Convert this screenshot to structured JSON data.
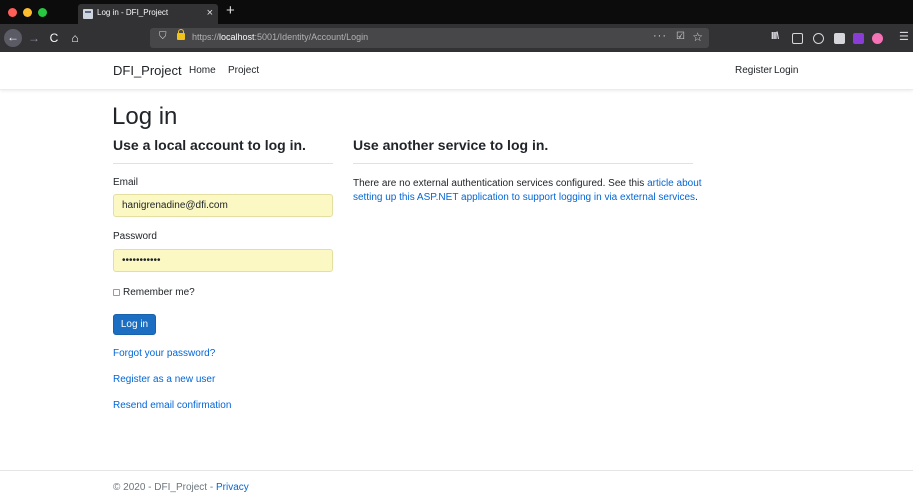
{
  "browser": {
    "tab_title": "Log in - DFI_Project",
    "tab_close": "×",
    "new_tab": "+",
    "url_scheme": "https://",
    "url_host": "localhost",
    "url_path": ":5001/Identity/Account/Login",
    "url_more": "···",
    "icons": [
      "back-icon",
      "forward-icon",
      "reload-icon",
      "home-icon",
      "shield-icon",
      "lock-icon",
      "pocket-icon",
      "bookmark-star-icon",
      "library-icon",
      "sidebar-icon",
      "account-icon",
      "extension-icon",
      "menu-icon"
    ],
    "back_glyph": "←",
    "forward_glyph": "→",
    "reload_glyph": "C",
    "home_glyph": "⌂",
    "shield_glyph": "⛉",
    "pocket_glyph": "☑",
    "star_glyph": "☆",
    "library_glyph": "III\\",
    "menu_glyph": "☰"
  },
  "site_nav": {
    "brand": "DFI_Project",
    "links": [
      "Home",
      "Project"
    ],
    "right_links": [
      "Register",
      "Login"
    ]
  },
  "main": {
    "title": "Log in",
    "local_heading": "Use a local account to log in.",
    "external_heading": "Use another service to log in.",
    "email_label": "Email",
    "email_value": "hanigrenadine@dfi.com",
    "password_label": "Password",
    "password_value": "•••••••••••",
    "remember_label": "Remember me?",
    "login_button": "Log in",
    "forgot_link": "Forgot your password?",
    "register_link": "Register as a new user",
    "resend_link": "Resend email confirmation",
    "external_text_before": "There are no external authentication services configured. See this ",
    "external_link": "article about setting up this ASP.NET application to support logging in via external services",
    "external_text_after": "."
  },
  "footer": {
    "text": "© 2020 - DFI_Project - ",
    "privacy_link": "Privacy"
  },
  "colors": {
    "primary": "#1b6ec2",
    "link": "#0366d6",
    "autofill": "#fbf8c4"
  }
}
